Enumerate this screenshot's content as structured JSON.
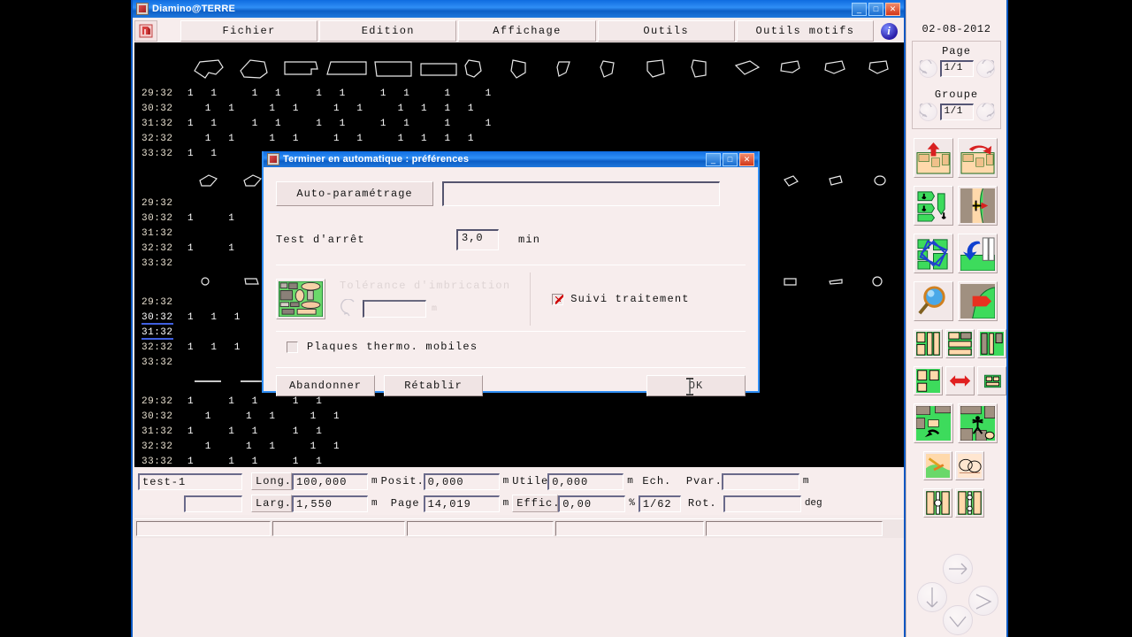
{
  "app": {
    "title": "Diamino@TERRE",
    "titlebar_icon": "app-icon",
    "window_buttons": {
      "minimize": "_",
      "maximize": "□",
      "close": "✕"
    }
  },
  "menubar": {
    "logo_icon": "diamino-logo-icon",
    "items": [
      {
        "label": "Fichier"
      },
      {
        "label": "Edition"
      },
      {
        "label": "Affichage"
      },
      {
        "label": "Outils"
      },
      {
        "label": "Outils motifs"
      }
    ],
    "info_icon": "info-icon",
    "info_glyph": "i"
  },
  "sidebar": {
    "date": "02-08-2012",
    "page": {
      "title": "Page",
      "value": "1/1",
      "prev_icon": "arrow-prev-icon",
      "next_icon": "arrow-next-icon"
    },
    "groupe": {
      "title": "Groupe",
      "value": "1/1",
      "prev_icon": "arrow-prev-icon",
      "next_icon": "arrow-next-icon"
    },
    "tools": [
      {
        "name": "nest-up-icon"
      },
      {
        "name": "nest-rotate-right-icon"
      },
      {
        "name": "nest-compact-down-icon"
      },
      {
        "name": "nest-split-merge-icon"
      },
      {
        "name": "nest-rotate-pattern-icon"
      },
      {
        "name": "nest-flip-left-icon"
      },
      {
        "name": "zoom-magnifier-icon"
      },
      {
        "name": "nest-extract-piece-icon"
      },
      {
        "name": "marker-columns-icon"
      },
      {
        "name": "marker-blocks-icon"
      },
      {
        "name": "marker-stripes-icon"
      },
      {
        "name": "marker-group-icon"
      },
      {
        "name": "swap-horizontal-icon"
      },
      {
        "name": "marker-small-icon"
      },
      {
        "name": "marker-measure-icon"
      },
      {
        "name": "marker-person-icon"
      },
      {
        "name": "pattern-match-icon"
      },
      {
        "name": "pattern-compare-icon"
      },
      {
        "name": "pattern-stripe-match-icon"
      },
      {
        "name": "pattern-stripe-compare-icon"
      }
    ],
    "pad": {
      "up_icon": "pad-up-icon",
      "left_icon": "pad-left-icon",
      "right_icon": "pad-right-icon",
      "down_icon": "pad-down-icon"
    }
  },
  "canvas": {
    "background": "#000000",
    "row_labels": [
      "29:32",
      "30:32",
      "31:32",
      "32:32",
      "33:32"
    ],
    "selected_labels": [
      "30:32",
      "31:32"
    ],
    "counter": "1",
    "blocks": [
      {
        "shapes": [
          "poly-6a",
          "poly-5a",
          "rect-notch",
          "rect-flat",
          "rect-wide",
          "rect-plain",
          "poly-dart",
          "poly-dart2",
          "tri-small",
          "tri-small2",
          "poly-slant",
          "poly-tall",
          "poly-quad",
          "poly-quad2",
          "poly-quad3",
          "poly-quad4"
        ],
        "ones": [
          "1   1      1   1      1   1      1   1      1      1",
          "   1   1      1   1      1   1      1   1   1   1",
          "1   1      1   1      1   1      1   1      1      1",
          "   1   1      1   1      1   1      1   1   1   1",
          "1   1"
        ]
      },
      {
        "shapes": [
          "small-quad",
          "small-quad2",
          "small-box",
          "small-dash",
          "small-circle"
        ],
        "ones": [
          "",
          "1      1",
          "",
          "1      1",
          ""
        ]
      },
      {
        "shapes": [
          "tiny-circle",
          "tiny-dash"
        ],
        "ones": [
          "",
          "1   1   1",
          "",
          "1   1   1",
          ""
        ]
      },
      {
        "shapes": [],
        "ones": [
          "1      1   1      1   1",
          "   1      1   1      1   1",
          "1      1   1      1   1",
          "   1      1   1      1   1",
          "1      1   1      1   1"
        ]
      }
    ]
  },
  "infopanel": {
    "marker_name": "test-1",
    "marker_name2": "",
    "fields": [
      {
        "label": "Long.",
        "value": "100,000",
        "unit": "m"
      },
      {
        "label": "Posit.",
        "value": "0,000",
        "unit": "m"
      },
      {
        "label": "Utile",
        "value": "0,000",
        "unit": "m"
      },
      {
        "label": "Larg.",
        "value": "1,550",
        "unit": "m"
      },
      {
        "label": "Page",
        "value": "14,019",
        "unit": "m"
      },
      {
        "label": "Effic.",
        "value": "0,00",
        "unit": "%"
      }
    ],
    "ech_label": "Ech.",
    "ech_value": "1/62",
    "pvar_label": "Pvar.",
    "pvar_value": "",
    "pvar_unit": "m",
    "rot_label": "Rot.",
    "rot_value": "",
    "rot_unit": "deg"
  },
  "statusbar": {
    "cells": [
      "",
      "",
      "",
      "",
      ""
    ]
  },
  "dialog": {
    "title": "Terminer en automatique : préférences",
    "titlebar_icon": "dialog-icon",
    "window_buttons": {
      "minimize": "_",
      "maximize": "□",
      "close": "✕"
    },
    "auto_param_button": "Auto-paramétrage",
    "auto_param_value": "",
    "test_arret_label": "Test d'arrêt",
    "test_arret_value": "3,0",
    "test_arret_unit": "min",
    "preview_icon": "nesting-preview-icon",
    "tolerance_label": "Tolérance d'imbrication",
    "tolerance_value": "",
    "tolerance_unit": "m",
    "tolerance_reset_icon": "reset-arrow-icon",
    "suivi_label": "Suivi traitement",
    "suivi_checked": true,
    "plaques_label": "Plaques thermo. mobiles",
    "plaques_checked": false,
    "abandonner_button": "Abandonner",
    "retablir_button": "Rétablir",
    "ok_button": "OK",
    "cursor_icon": "text-ibeam-cursor"
  }
}
